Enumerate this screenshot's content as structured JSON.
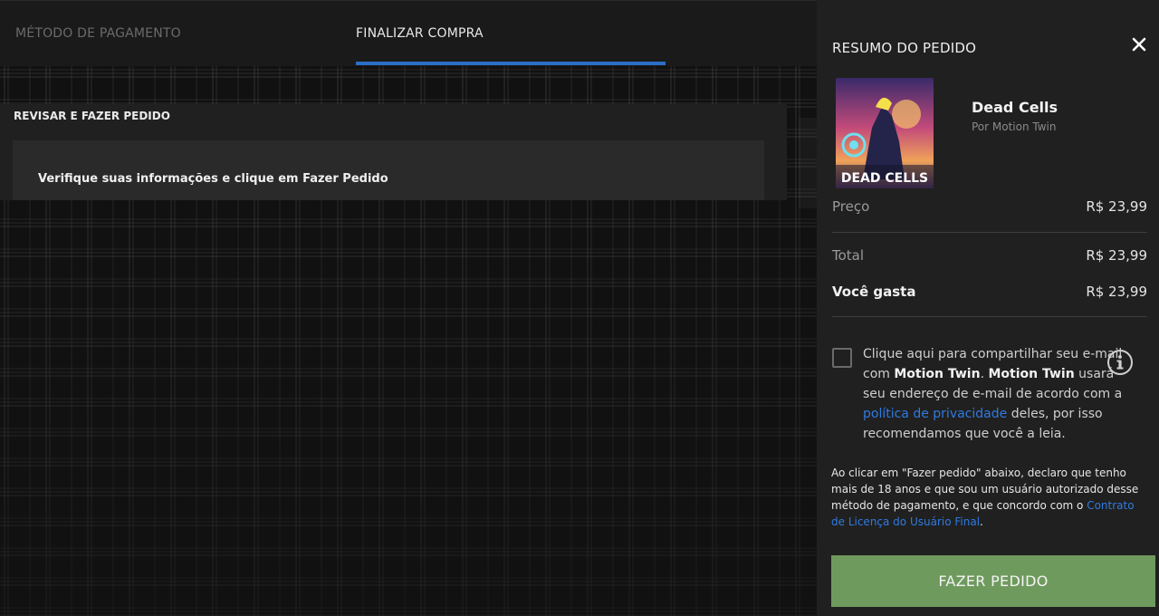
{
  "tabs": [
    {
      "label": "MÉTODO DE PAGAMENTO",
      "active": false
    },
    {
      "label": "FINALIZAR COMPRA",
      "active": true
    }
  ],
  "review": {
    "heading": "REVISAR E FAZER PEDIDO",
    "message": "Verifique suas informações e clique em Fazer Pedido"
  },
  "summary": {
    "title": "RESUMO DO PEDIDO",
    "close_icon": "close-icon",
    "product": {
      "title": "Dead Cells",
      "publisher": "Por Motion Twin",
      "cover_text": "DEAD CELLS"
    },
    "price": {
      "label": "Preço",
      "value": "R$ 23,99"
    },
    "total": {
      "label": "Total",
      "value": "R$ 23,99"
    },
    "spend": {
      "label": "Você gasta",
      "value": "R$ 23,99"
    },
    "share": {
      "t1": "Clique aqui para compartilhar seu e-mail com ",
      "dev1": "Motion Twin",
      "t2": ". ",
      "dev2": "Motion Twin",
      "t3": " usará seu endereço de e-mail de acordo com a ",
      "link": "política de privacidade",
      "t4": " deles, por isso recomendamos que você a leia."
    },
    "legal": {
      "text": "Ao clicar em \"Fazer pedido\" abaixo, declaro que tenho mais de 18 anos e que sou um usuário autorizado desse método de pagamento, e que concordo com o ",
      "link": "Contrato de Licença do Usuário Final",
      "end": "."
    },
    "button_label": "FAZER PEDIDO",
    "colors": {
      "accent": "#2a6ec6",
      "button": "#6f9a5e",
      "link": "#2f7ae0"
    }
  }
}
